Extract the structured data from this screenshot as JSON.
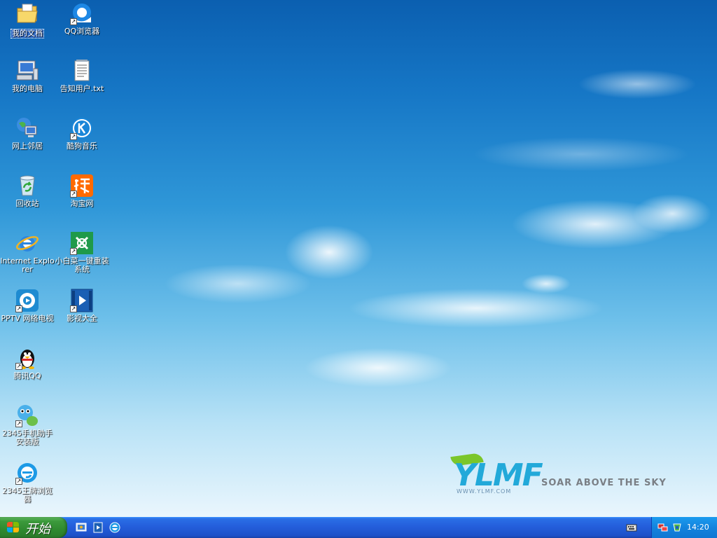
{
  "desktop_icons": [
    {
      "label": "我的文档",
      "icon": "folder-documents-icon",
      "selected": true
    },
    {
      "label": "QQ浏览器",
      "icon": "qq-browser-icon"
    },
    {
      "label": "我的电脑",
      "icon": "my-computer-icon"
    },
    {
      "label": "告知用户.txt",
      "icon": "text-file-icon"
    },
    {
      "label": "网上邻居",
      "icon": "network-places-icon"
    },
    {
      "label": "酷狗音乐",
      "icon": "kugou-music-icon"
    },
    {
      "label": "回收站",
      "icon": "recycle-bin-icon"
    },
    {
      "label": "淘宝网",
      "icon": "taobao-icon"
    },
    {
      "label": "Internet Explorer",
      "icon": "internet-explorer-icon"
    },
    {
      "label": "小白菜一键重装系统",
      "icon": "reinstall-system-icon"
    },
    {
      "label": "PPTV 网络电视",
      "icon": "pptv-icon"
    },
    {
      "label": "影视大全",
      "icon": "video-player-icon"
    },
    {
      "label": "腾讯QQ",
      "icon": "qq-penguin-icon"
    },
    {
      "label": "2345手机助手安装版",
      "icon": "phone-assistant-icon"
    },
    {
      "label": "2345王牌浏览器",
      "icon": "2345-browser-icon"
    }
  ],
  "wallpaper_logo": {
    "brand": "YLMF",
    "slogan": "SOAR ABOVE THE SKY",
    "url": "WWW.YLMF.COM"
  },
  "taskbar": {
    "start_label": "开始",
    "quick_launch": [
      "show-desktop-icon",
      "media-player-icon",
      "browser-icon"
    ],
    "tray_icons": [
      "keyboard-icon",
      "network-icon",
      "security-icon"
    ],
    "clock": "14:20"
  },
  "colors": {
    "taskbar": "#245edb",
    "start_button": "#3c9a3c",
    "tray": "#1383dd",
    "selection": "#316ac5"
  }
}
